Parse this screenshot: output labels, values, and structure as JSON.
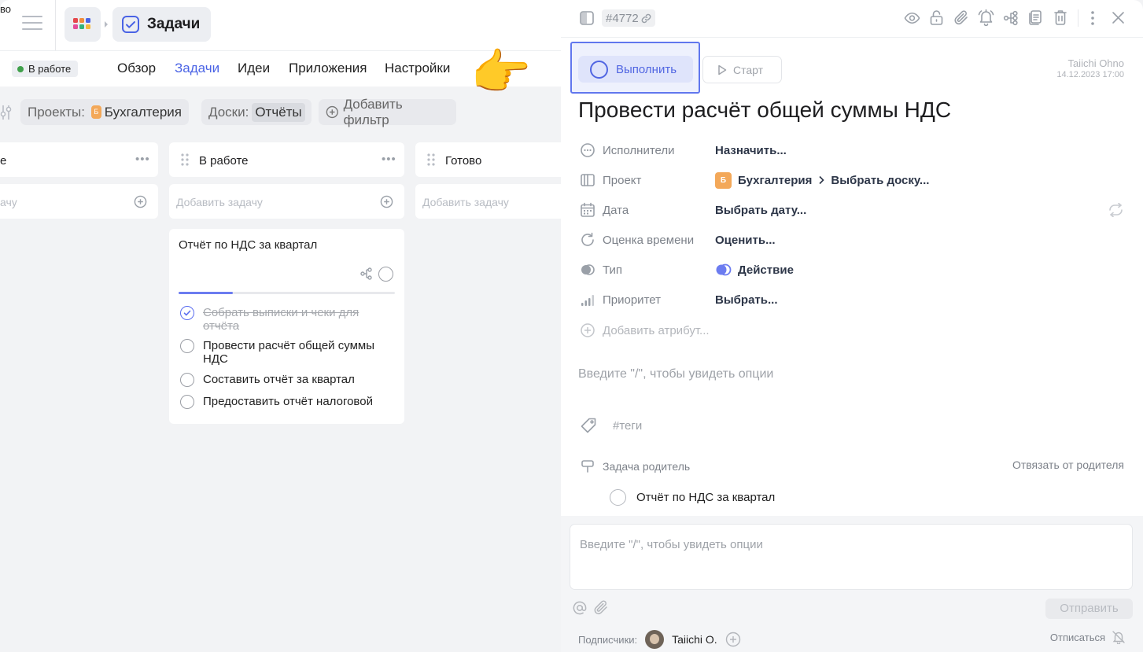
{
  "left": {
    "clip_text": "во",
    "app_title": "Задачи",
    "status_pill": "В работе",
    "nav": [
      "Обзор",
      "Задачи",
      "Идеи",
      "Приложения",
      "Настройки"
    ],
    "filters": {
      "projects_label": "Проекты:",
      "projects_badge": "Б",
      "projects_value": "Бухгалтерия",
      "boards_label": "Доски:",
      "boards_value": "Отчёты",
      "add_filter": "Добавить фильтр"
    },
    "columns": [
      {
        "title": "е",
        "add_placeholder": "ачу"
      },
      {
        "title": "В работе",
        "add_placeholder": "Добавить задачу"
      },
      {
        "title": "Готово",
        "add_placeholder": "Добавить задачу"
      }
    ],
    "card": {
      "title": "Отчёт по НДС за квартал",
      "progress": 0.25,
      "subtasks": [
        {
          "text": "Собрать выписки и чеки для отчёта",
          "done": true
        },
        {
          "text": "Провести расчёт общей суммы НДС",
          "done": false
        },
        {
          "text": "Составить отчёт за квартал",
          "done": false
        },
        {
          "text": "Предоставить отчёт налоговой",
          "done": false
        }
      ]
    }
  },
  "panel": {
    "task_id": "#4772",
    "complete_label": "Выполнить",
    "start_label": "Старт",
    "author": "Taiichi Ohno",
    "created": "14.12.2023 17:00",
    "title": "Провести расчёт общей суммы НДС",
    "props": {
      "assignees_label": "Исполнители",
      "assignees_value": "Назначить...",
      "project_label": "Проект",
      "project_badge": "Б",
      "project_value": "Бухгалтерия",
      "project_board": "Выбрать доску...",
      "date_label": "Дата",
      "date_value": "Выбрать дату...",
      "estimate_label": "Оценка времени",
      "estimate_value": "Оценить...",
      "type_label": "Тип",
      "type_value": "Действие",
      "priority_label": "Приоритет",
      "priority_value": "Выбрать...",
      "add_attr": "Добавить атрибут..."
    },
    "editor_placeholder": "Введите \"/\", чтобы увидеть опции",
    "tags_placeholder": "#теги",
    "parent_label": "Задача родитель",
    "unlink_parent": "Отвязать от родителя",
    "parent_task": "Отчёт по НДС за квартал",
    "comment_placeholder": "Введите \"/\", чтобы увидеть опции",
    "send_label": "Отправить",
    "subscribers_label": "Подписчики:",
    "subscriber_name": "Taiichi O.",
    "unsubscribe": "Отписаться"
  },
  "colors": {
    "accent": "#4a63e5",
    "status_green": "#3fa04a",
    "project_orange": "#f3a859"
  }
}
